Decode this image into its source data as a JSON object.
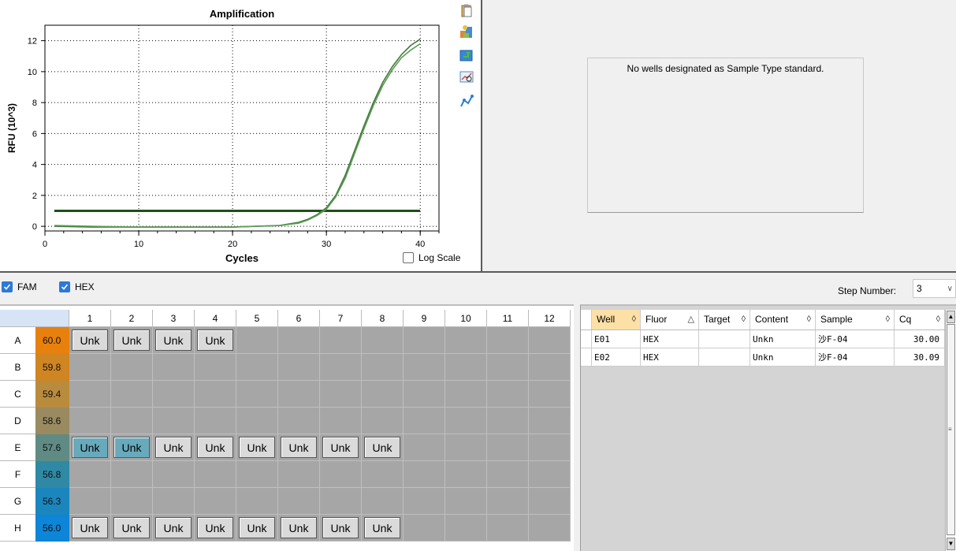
{
  "chart_data": {
    "type": "line",
    "title": "Amplification",
    "xlabel": "Cycles",
    "ylabel": "RFU (10^3)",
    "xlim": [
      0,
      42
    ],
    "ylim": [
      -0.3,
      13
    ],
    "x_ticks": [
      0,
      10,
      20,
      30,
      40
    ],
    "y_ticks": [
      0,
      2,
      4,
      6,
      8,
      10,
      12
    ],
    "grid": true,
    "grid_style": "dotted",
    "series": [
      {
        "color": "#3f7a38",
        "x": [
          1,
          5,
          10,
          15,
          20,
          25,
          27,
          28,
          29,
          30,
          31,
          32,
          33,
          34,
          35,
          36,
          37,
          38,
          39,
          40
        ],
        "y": [
          0.0,
          -0.05,
          -0.05,
          -0.05,
          -0.05,
          0.05,
          0.25,
          0.45,
          0.75,
          1.2,
          2.0,
          3.3,
          4.9,
          6.5,
          8.0,
          9.3,
          10.3,
          11.1,
          11.7,
          12.1
        ]
      },
      {
        "color": "#5c9a56",
        "x": [
          1,
          5,
          10,
          15,
          20,
          25,
          27,
          28,
          29,
          30,
          31,
          32,
          33,
          34,
          35,
          36,
          37,
          38,
          39,
          40
        ],
        "y": [
          0.05,
          0.0,
          -0.05,
          -0.05,
          -0.05,
          0.05,
          0.2,
          0.4,
          0.7,
          1.1,
          1.9,
          3.1,
          4.7,
          6.3,
          7.8,
          9.1,
          10.1,
          10.9,
          11.4,
          11.8
        ]
      }
    ],
    "threshold": {
      "y": 1.0,
      "x_range": [
        1,
        40
      ],
      "color": "#1f4f1a"
    }
  },
  "chart_controls": {
    "log_scale_label": "Log Scale",
    "log_scale_checked": false,
    "toolbar_icons": [
      "copy-icon",
      "export-icon",
      "refresh-icon",
      "zoom-icon",
      "chart-settings-icon"
    ]
  },
  "standard_curve": {
    "message": "No wells designated as Sample Type standard."
  },
  "fluorophores": [
    {
      "label": "FAM",
      "checked": true
    },
    {
      "label": "HEX",
      "checked": true
    }
  ],
  "step": {
    "label": "Step Number:",
    "value": "3"
  },
  "plate": {
    "columns": [
      "1",
      "2",
      "3",
      "4",
      "5",
      "6",
      "7",
      "8",
      "9",
      "10",
      "11",
      "12"
    ],
    "rows": [
      {
        "label": "A",
        "temp": "60.0",
        "color": "#e7800d",
        "wells": [
          "Unk",
          "Unk",
          "Unk",
          "Unk",
          "",
          "",
          "",
          "",
          "",
          "",
          "",
          ""
        ]
      },
      {
        "label": "B",
        "temp": "59.8",
        "color": "#cf8521",
        "wells": [
          "",
          "",
          "",
          "",
          "",
          "",
          "",
          "",
          "",
          "",
          "",
          ""
        ]
      },
      {
        "label": "C",
        "temp": "59.4",
        "color": "#b98b3d",
        "wells": [
          "",
          "",
          "",
          "",
          "",
          "",
          "",
          "",
          "",
          "",
          "",
          ""
        ]
      },
      {
        "label": "D",
        "temp": "58.6",
        "color": "#9a8a60",
        "wells": [
          "",
          "",
          "",
          "",
          "",
          "",
          "",
          "",
          "",
          "",
          "",
          ""
        ]
      },
      {
        "label": "E",
        "temp": "57.6",
        "color": "#5f8b84",
        "wells": [
          "Unk",
          "Unk",
          "Unk",
          "Unk",
          "Unk",
          "Unk",
          "Unk",
          "Unk",
          "",
          "",
          "",
          ""
        ]
      },
      {
        "label": "F",
        "temp": "56.8",
        "color": "#2f89a4",
        "wells": [
          "",
          "",
          "",
          "",
          "",
          "",
          "",
          "",
          "",
          "",
          "",
          ""
        ]
      },
      {
        "label": "G",
        "temp": "56.3",
        "color": "#1a86bd",
        "wells": [
          "",
          "",
          "",
          "",
          "",
          "",
          "",
          "",
          "",
          "",
          "",
          ""
        ]
      },
      {
        "label": "H",
        "temp": "56.0",
        "color": "#0d85d8",
        "wells": [
          "Unk",
          "Unk",
          "Unk",
          "Unk",
          "Unk",
          "Unk",
          "Unk",
          "Unk",
          "",
          "",
          "",
          ""
        ]
      }
    ],
    "selected": [
      "E1",
      "E2"
    ]
  },
  "results_table": {
    "columns": [
      {
        "label": "Well",
        "sort": "◊",
        "active": true
      },
      {
        "label": "Fluor",
        "sort": "△",
        "active": false
      },
      {
        "label": "Target",
        "sort": "◊",
        "active": false
      },
      {
        "label": "Content",
        "sort": "◊",
        "active": false
      },
      {
        "label": "Sample",
        "sort": "◊",
        "active": false
      },
      {
        "label": "Cq",
        "sort": "◊",
        "active": false
      }
    ],
    "rows": [
      {
        "well": "E01",
        "fluor": "HEX",
        "target": "",
        "content": "Unkn",
        "sample": "沙F-04",
        "cq": "30.00"
      },
      {
        "well": "E02",
        "fluor": "HEX",
        "target": "",
        "content": "Unkn",
        "sample": "沙F-04",
        "cq": "30.09"
      }
    ]
  }
}
